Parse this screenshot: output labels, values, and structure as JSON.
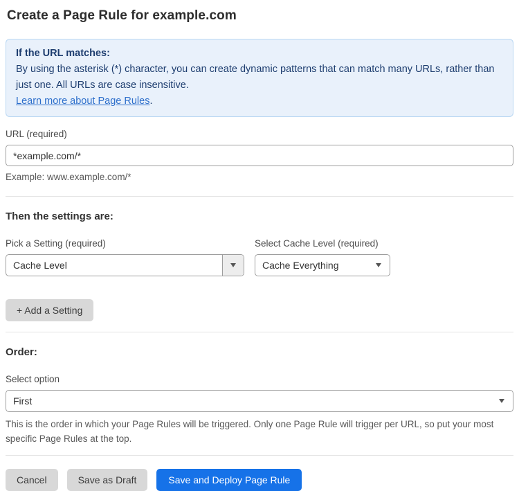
{
  "page": {
    "title": "Create a Page Rule for example.com"
  },
  "info_box": {
    "heading": "If the URL matches:",
    "body": "By using the asterisk (*) character, you can create dynamic patterns that can match many URLs, rather than just one. All URLs are case insensitive.",
    "link": "Learn more about Page Rules",
    "link_suffix": "."
  },
  "url_field": {
    "label": "URL (required)",
    "value": "*example.com/*",
    "helper": "Example: www.example.com/*"
  },
  "settings": {
    "heading": "Then the settings are:",
    "setting_label": "Pick a Setting (required)",
    "setting_value": "Cache Level",
    "cache_label": "Select Cache Level (required)",
    "cache_value": "Cache Everything",
    "add_button": "+ Add a Setting"
  },
  "order": {
    "heading": "Order:",
    "label": "Select option",
    "value": "First",
    "helper": "This is the order in which your Page Rules will be triggered. Only one Page Rule will trigger per URL, so put your most specific Page Rules at the top."
  },
  "actions": {
    "cancel": "Cancel",
    "save_draft": "Save as Draft",
    "save_deploy": "Save and Deploy Page Rule"
  },
  "colors": {
    "info_background": "#e9f1fb",
    "info_border": "#b9d7f3",
    "info_text": "#1d3d6f",
    "link": "#2c6ecb",
    "primary_button": "#1672e8",
    "gray_button": "#d8d8d8"
  }
}
